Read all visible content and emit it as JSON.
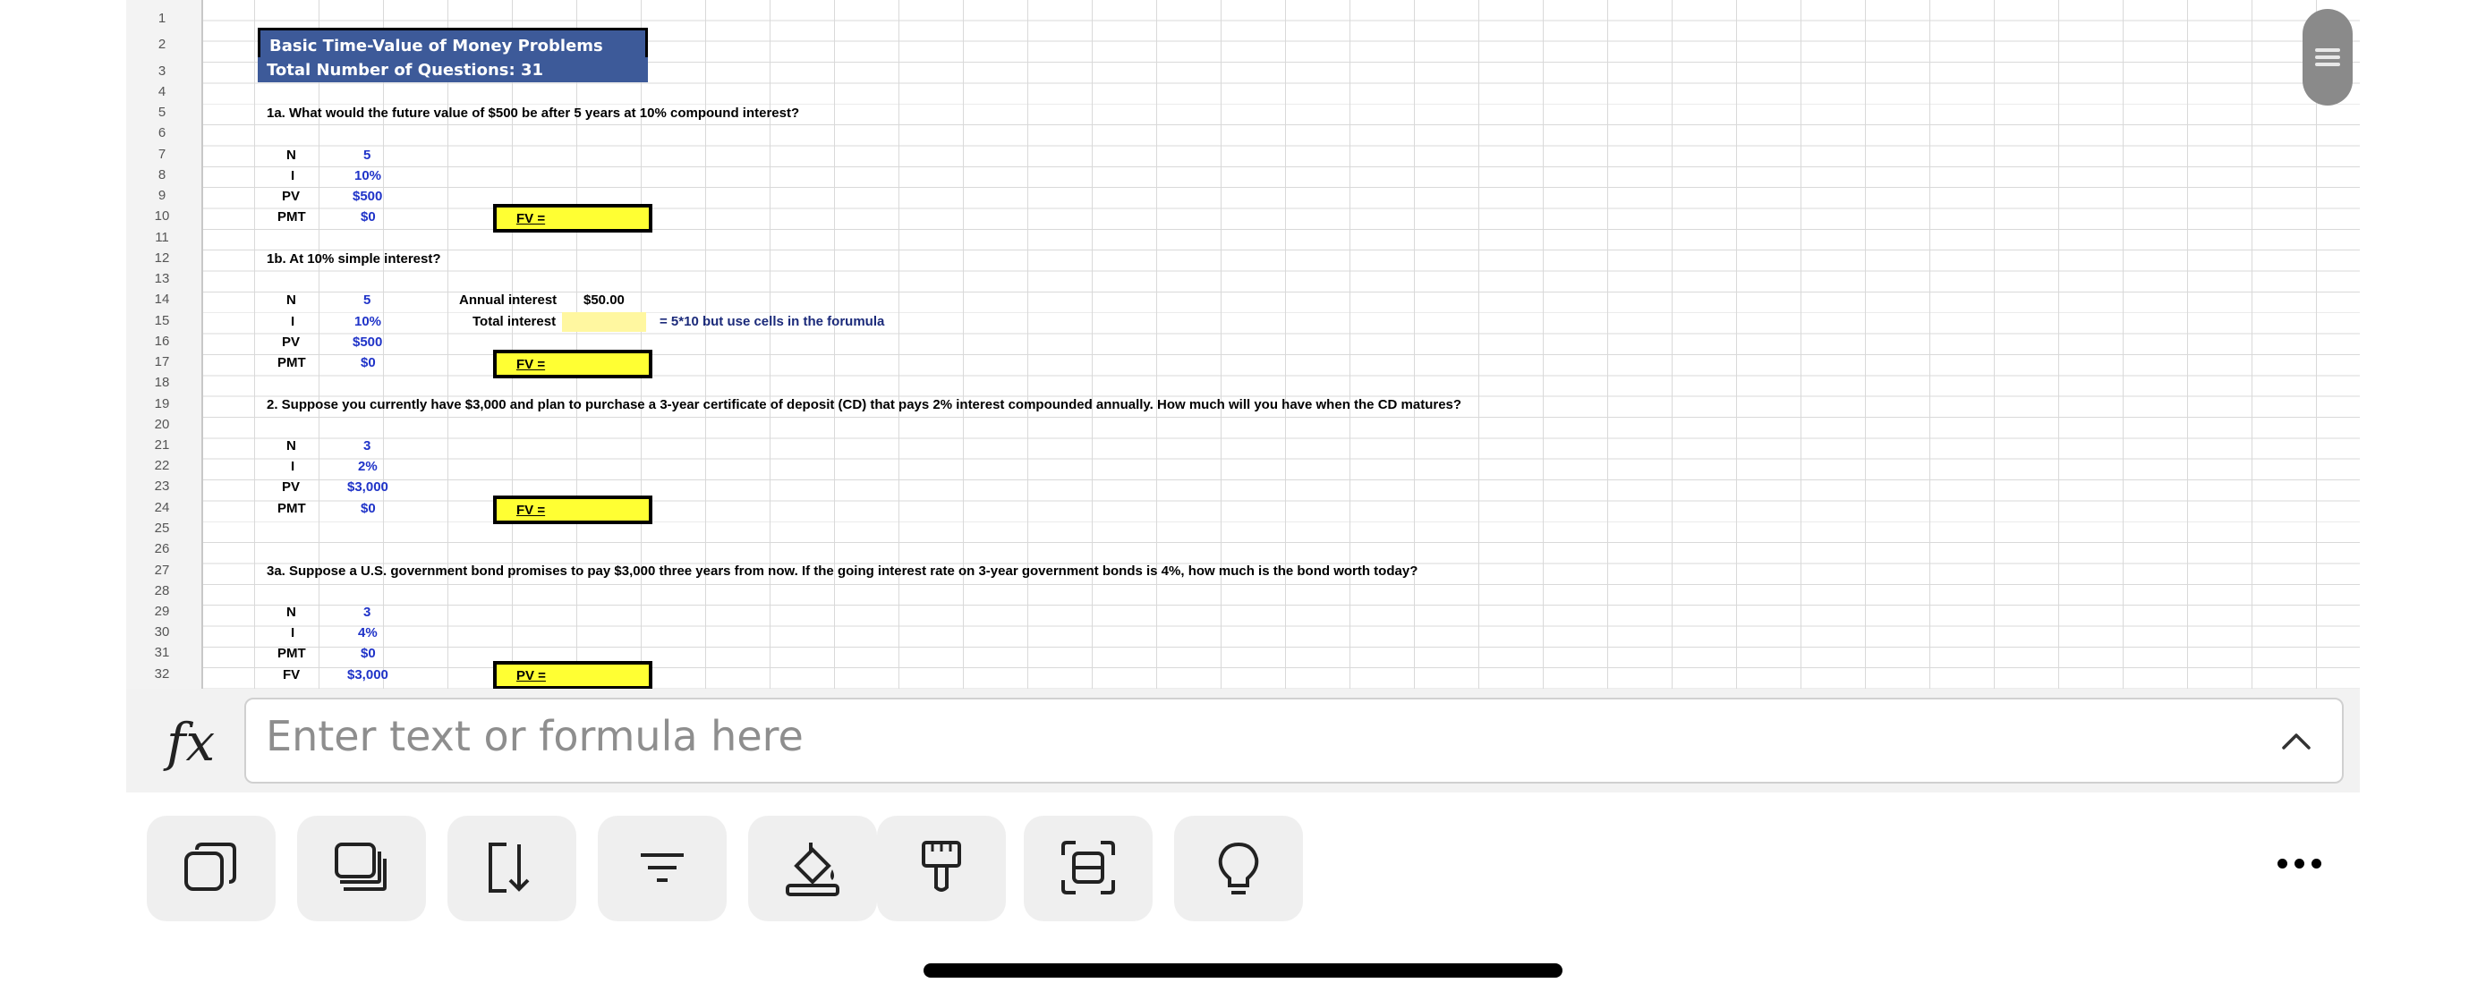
{
  "sheet": {
    "row_numbers": [
      "1",
      "2",
      "3",
      "4",
      "5",
      "6",
      "7",
      "8",
      "9",
      "10",
      "11",
      "12",
      "13",
      "14",
      "15",
      "16",
      "17",
      "18",
      "19",
      "20",
      "21",
      "22",
      "23",
      "24",
      "25",
      "26",
      "27",
      "28",
      "29",
      "30",
      "31",
      "32"
    ],
    "title": "Basic Time-Value of Money Problems",
    "subtitle": "Total Number of Questions: 31",
    "q1a": {
      "question": "1a.  What would the future value of $500 be after 5 years at 10% compound interest?",
      "labels": [
        "N",
        "I",
        "PV",
        "PMT"
      ],
      "values": [
        "5",
        "10%",
        "$500",
        "$0"
      ],
      "answer_label": "FV ="
    },
    "q1b": {
      "question": "1b.  At 10% simple interest?",
      "labels": [
        "N",
        "I",
        "PV",
        "PMT"
      ],
      "values": [
        "5",
        "10%",
        "$500",
        "$0"
      ],
      "annual_interest_label": "Annual interest",
      "annual_interest_value": "$50.00",
      "total_interest_label": "Total interest",
      "total_interest_note": "= 5*10 but use cells in the forumula",
      "answer_label": "FV ="
    },
    "q2": {
      "question": "2.  Suppose you currently have $3,000 and plan to purchase a 3-year certificate of deposit (CD) that pays 2% interest compounded annually.  How much will you have when the CD matures?",
      "labels": [
        "N",
        "I",
        "PV",
        "PMT"
      ],
      "values": [
        "3",
        "2%",
        "$3,000",
        "$0"
      ],
      "answer_label": "FV ="
    },
    "q3a": {
      "question": "3a.  Suppose a U.S. government bond promises to pay $3,000 three years from now.  If the going interest rate on 3-year government bonds is 4%, how much is the bond worth today?",
      "labels": [
        "N",
        "I",
        "PMT",
        "FV"
      ],
      "values": [
        "3",
        "4%",
        "$0",
        "$3,000"
      ],
      "answer_label": "PV ="
    }
  },
  "formula_bar": {
    "icon": "fx-icon",
    "placeholder": "Enter text or formula here"
  },
  "toolbar": {
    "buttons": [
      "copy-icon",
      "duplicate-icon",
      "fill-down-icon",
      "filter-icon",
      "fill-color-icon",
      "format-painter-icon",
      "select-range-icon",
      "ideas-icon"
    ],
    "more": "more-icon"
  },
  "colors": {
    "header_bg": "#3d5a99",
    "answer_fill": "#ffff33",
    "input_blue": "#1f33c8"
  }
}
